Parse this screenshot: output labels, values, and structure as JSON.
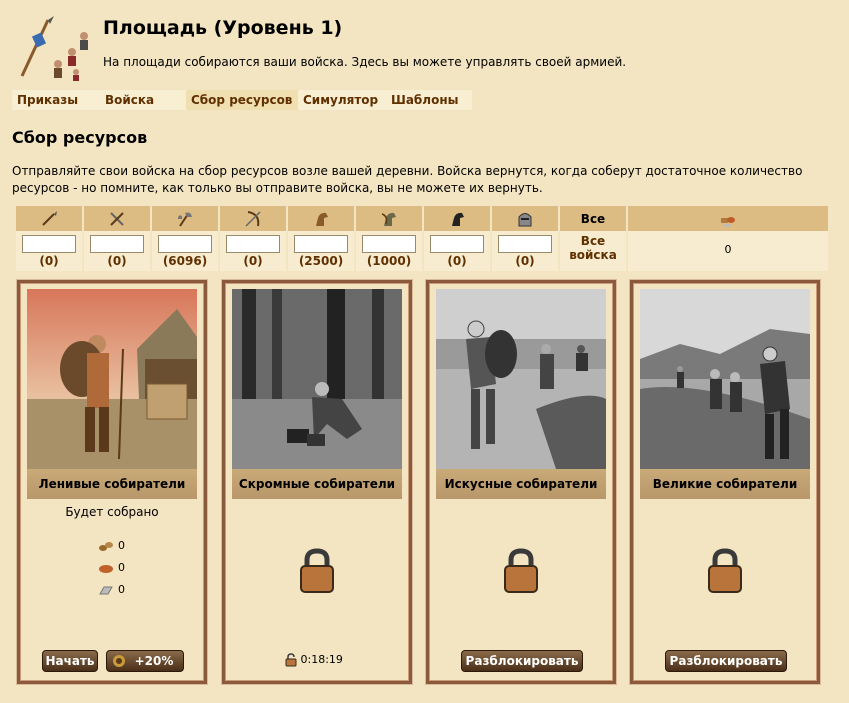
{
  "header": {
    "title": "Площадь (Уровень 1)",
    "description": "На площади собираются ваши войска. Здесь вы можете управлять своей армией."
  },
  "tabs": [
    {
      "label": "Приказы",
      "active": false
    },
    {
      "label": "Войска",
      "active": false
    },
    {
      "label": "Сбор ресурсов",
      "active": true
    },
    {
      "label": "Симулятор",
      "active": false
    },
    {
      "label": "Шаблоны",
      "active": false
    }
  ],
  "section": {
    "title": "Сбор ресурсов",
    "description": "Отправляйте свои войска на сбор ресурсов возле вашей деревни. Войска вернутся, когда соберут достаточное количество ресурсов - но помните, как только вы отправите войска, вы не можете их вернуть."
  },
  "troops": {
    "units": [
      {
        "icon": "spear-icon",
        "count": "(0)"
      },
      {
        "icon": "sword-icon",
        "count": "(0)"
      },
      {
        "icon": "axe-icon",
        "count": "(6096)"
      },
      {
        "icon": "bow-icon",
        "count": "(0)"
      },
      {
        "icon": "light-cavalry-icon",
        "count": "(2500)"
      },
      {
        "icon": "mounted-archer-icon",
        "count": "(1000)"
      },
      {
        "icon": "heavy-cavalry-icon",
        "count": "(0)"
      },
      {
        "icon": "knight-icon",
        "count": "(0)"
      }
    ],
    "all_header": "Все",
    "all_link": "Все войска",
    "carry_icon": "resources-icon",
    "carry_value": "0"
  },
  "options": [
    {
      "name": "Ленивые собиратели",
      "locked": false,
      "will_collect": "Будет собрано",
      "wood": "0",
      "clay": "0",
      "iron": "0",
      "start_label": "Начать",
      "bonus_label": "+20%"
    },
    {
      "name": "Скромные собиратели",
      "locked": true,
      "timer": "0:18:19"
    },
    {
      "name": "Искусные собиратели",
      "locked": true,
      "unlock_label": "Разблокировать"
    },
    {
      "name": "Великие собиратели",
      "locked": true,
      "unlock_label": "Разблокировать"
    }
  ],
  "colors": {
    "background": "#f3e5c1",
    "header_cell": "#dcbc83",
    "link": "#603000",
    "card_border": "#8b5a3c"
  }
}
